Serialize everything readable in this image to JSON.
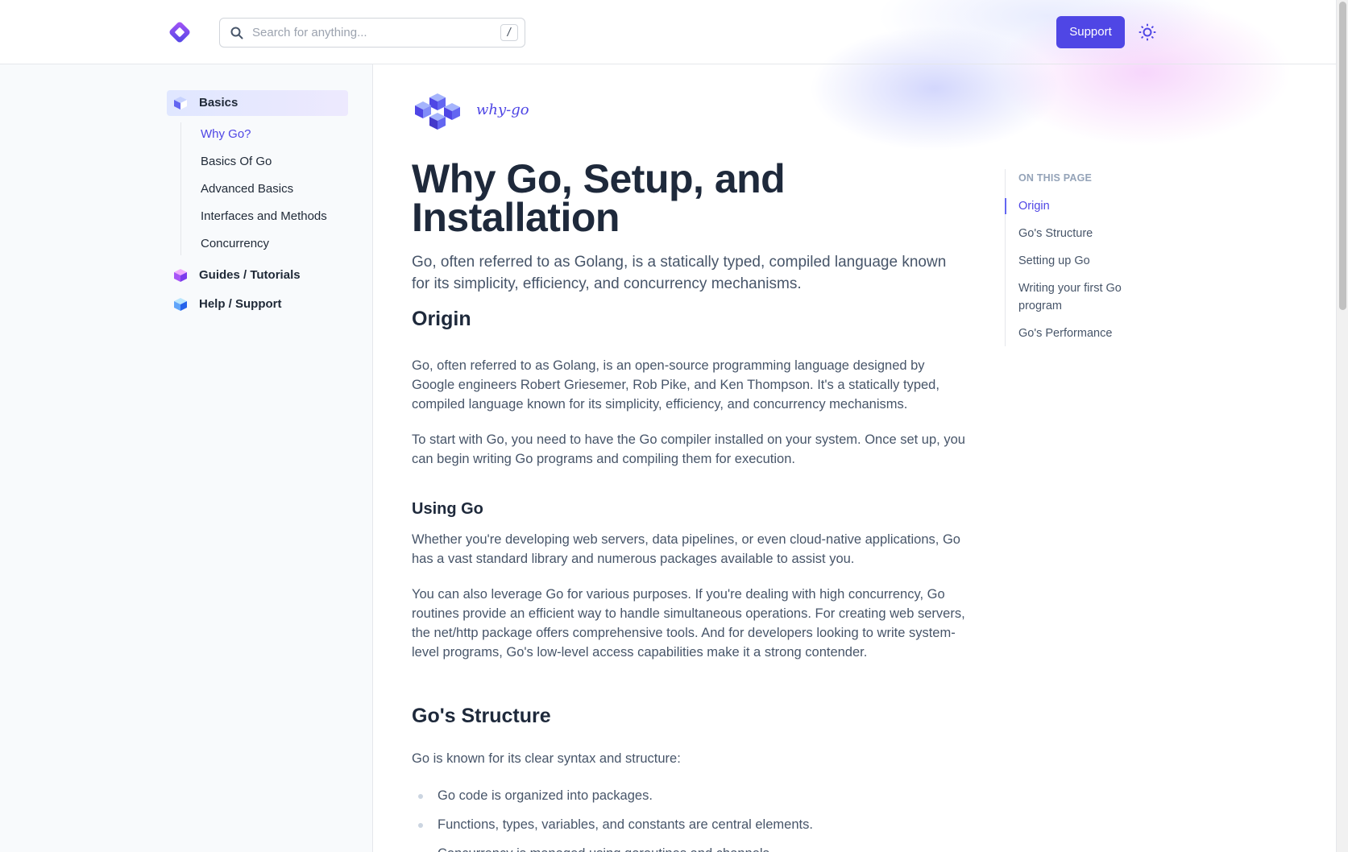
{
  "header": {
    "search_placeholder": "Search for anything...",
    "search_shortcut": "/",
    "support_label": "Support",
    "theme_icon": "sun-icon"
  },
  "sidebar": {
    "groups": [
      {
        "label": "Basics",
        "active": true
      },
      {
        "label": "Guides / Tutorials",
        "active": false
      },
      {
        "label": "Help / Support",
        "active": false
      }
    ],
    "items": [
      {
        "label": "Why Go?",
        "active": true
      },
      {
        "label": "Basics Of Go"
      },
      {
        "label": "Advanced Basics"
      },
      {
        "label": "Interfaces and Methods"
      },
      {
        "label": "Concurrency"
      }
    ]
  },
  "main": {
    "brand_text": "why-go",
    "title": "Why Go, Setup, and Installation",
    "lead": "Go, often referred to as Golang, is a statically typed, compiled language known for its simplicity, efficiency, and concurrency mechanisms.",
    "origin_heading": "Origin",
    "origin_p1": "Go, often referred to as Golang, is an open-source programming language designed by Google engineers Robert Griesemer, Rob Pike, and Ken Thompson. It's a statically typed, compiled language known for its simplicity, efficiency, and concurrency mechanisms.",
    "origin_p2": "To start with Go, you need to have the Go compiler installed on your system. Once set up, you can begin writing Go programs and compiling them for execution.",
    "using_heading": "Using Go",
    "using_p1": "Whether you're developing web servers, data pipelines, or even cloud-native applications, Go has a vast standard library and numerous packages available to assist you.",
    "using_p2": "You can also leverage Go for various purposes. If you're dealing with high concurrency, Go routines provide an efficient way to handle simultaneous operations. For creating web servers, the net/http package offers comprehensive tools. And for developers looking to write system-level programs, Go's low-level access capabilities make it a strong contender.",
    "structure_heading": "Go's Structure",
    "structure_intro": "Go is known for its clear syntax and structure:",
    "structure_bullets": [
      "Go code is organized into packages.",
      "Functions, types, variables, and constants are central elements.",
      "Concurrency is managed using goroutines and channels."
    ]
  },
  "toc": {
    "title": "ON THIS PAGE",
    "items": [
      {
        "label": "Origin",
        "active": true
      },
      {
        "label": "Go's Structure"
      },
      {
        "label": "Setting up Go"
      },
      {
        "label": "Writing your first Go program"
      },
      {
        "label": "Go's Performance"
      }
    ]
  },
  "colors": {
    "accent": "#4f46e5",
    "sidebar_bg": "#f8fafc",
    "heading": "#1e293b",
    "body_text": "#475569"
  }
}
